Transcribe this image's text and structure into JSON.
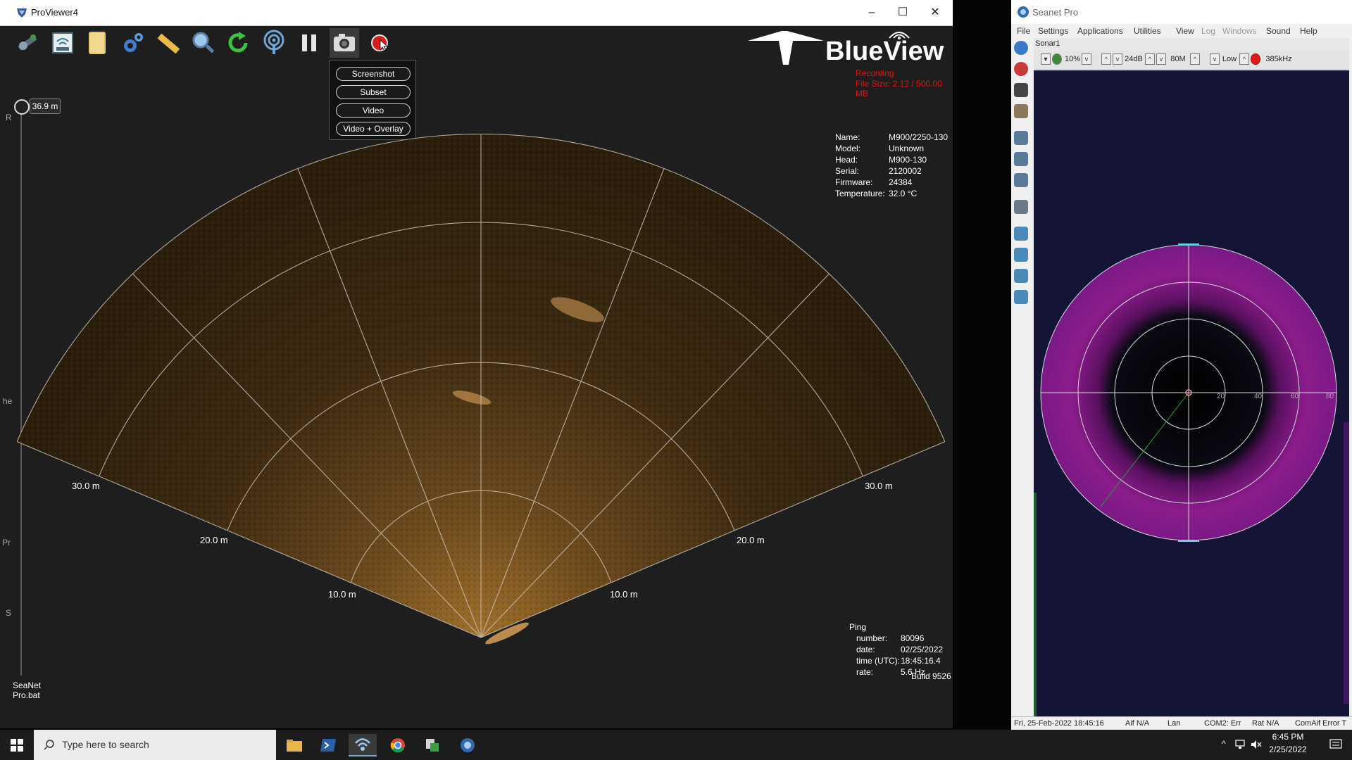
{
  "proviewer": {
    "title": "ProViewer4",
    "toolbar": [
      "connect-icon",
      "network-icon",
      "folder-icon",
      "settings-icon",
      "ruler-icon",
      "zoom-icon",
      "refresh-icon",
      "ping-icon",
      "pause-icon",
      "camera-icon",
      "record-icon"
    ],
    "capture_menu": {
      "screenshot": "Screenshot",
      "subset": "Subset",
      "video": "Video",
      "video_overlay": "Video + Overlay"
    },
    "brand": "BlueView",
    "recording": "Recording",
    "file_size": "File Size: 2.12 / 500.00 MB",
    "range_value": "36.9 m",
    "device": {
      "name_label": "Name:",
      "name": "M900/2250-130",
      "model_label": "Model:",
      "model": "Unknown",
      "head_label": "Head:",
      "head": "M900-130",
      "serial_label": "Serial:",
      "serial": "2120002",
      "firmware_label": "Firmware:",
      "firmware": "24384",
      "temperature_label": "Temperature:",
      "temperature": "32.0 °C"
    },
    "range_rings": {
      "r10_left": "10.0 m",
      "r10_right": "10.0 m",
      "r20_left": "20.0 m",
      "r20_right": "20.0 m",
      "r30_left": "30.0 m",
      "r30_right": "30.0 m"
    },
    "ping": {
      "header": "Ping",
      "number_label": "number:",
      "number": "80096",
      "date_label": "date:",
      "date": "02/25/2022",
      "time_label": "time (UTC):",
      "time": "18:45:16.4",
      "rate_label": "rate:",
      "rate": "5.6 Hz"
    },
    "build": "Build 9526",
    "window_controls": {
      "minimize": "–",
      "maximize": "☐",
      "close": "✕"
    }
  },
  "desktop": {
    "icon_label_1": "SeaNet",
    "icon_label_2": "Pro.bat",
    "edge_letters": [
      "R",
      "he",
      "Pr",
      "S"
    ]
  },
  "seanet": {
    "title": "Seanet Pro",
    "menu": [
      "File",
      "Settings",
      "Applications",
      "Utilities",
      "View",
      "Log",
      "Windows",
      "Sound",
      "Help"
    ],
    "document_title": "Sonar1",
    "controls": {
      "gain": "10%",
      "contrast": "24dB",
      "range": "80M",
      "resolution": "Low",
      "frequency": "385kHz"
    },
    "polar_labels": [
      "20",
      "40",
      "60",
      "80"
    ],
    "status": {
      "datetime": "Fri, 25-Feb-2022 18:45:16",
      "aif": "Aif N/A",
      "lan": "Lan",
      "com2": "COM2: Err",
      "rat": "Rat N/A",
      "comaif": "ComAif Error T"
    }
  },
  "taskbar": {
    "search_placeholder": "Type here to search",
    "apps": [
      "file-explorer-icon",
      "powershell-icon",
      "proviewer-icon",
      "chrome-icon",
      "app-icon",
      "seanet-icon"
    ],
    "clock_time": "6:45 PM",
    "clock_date": "2/25/2022"
  }
}
